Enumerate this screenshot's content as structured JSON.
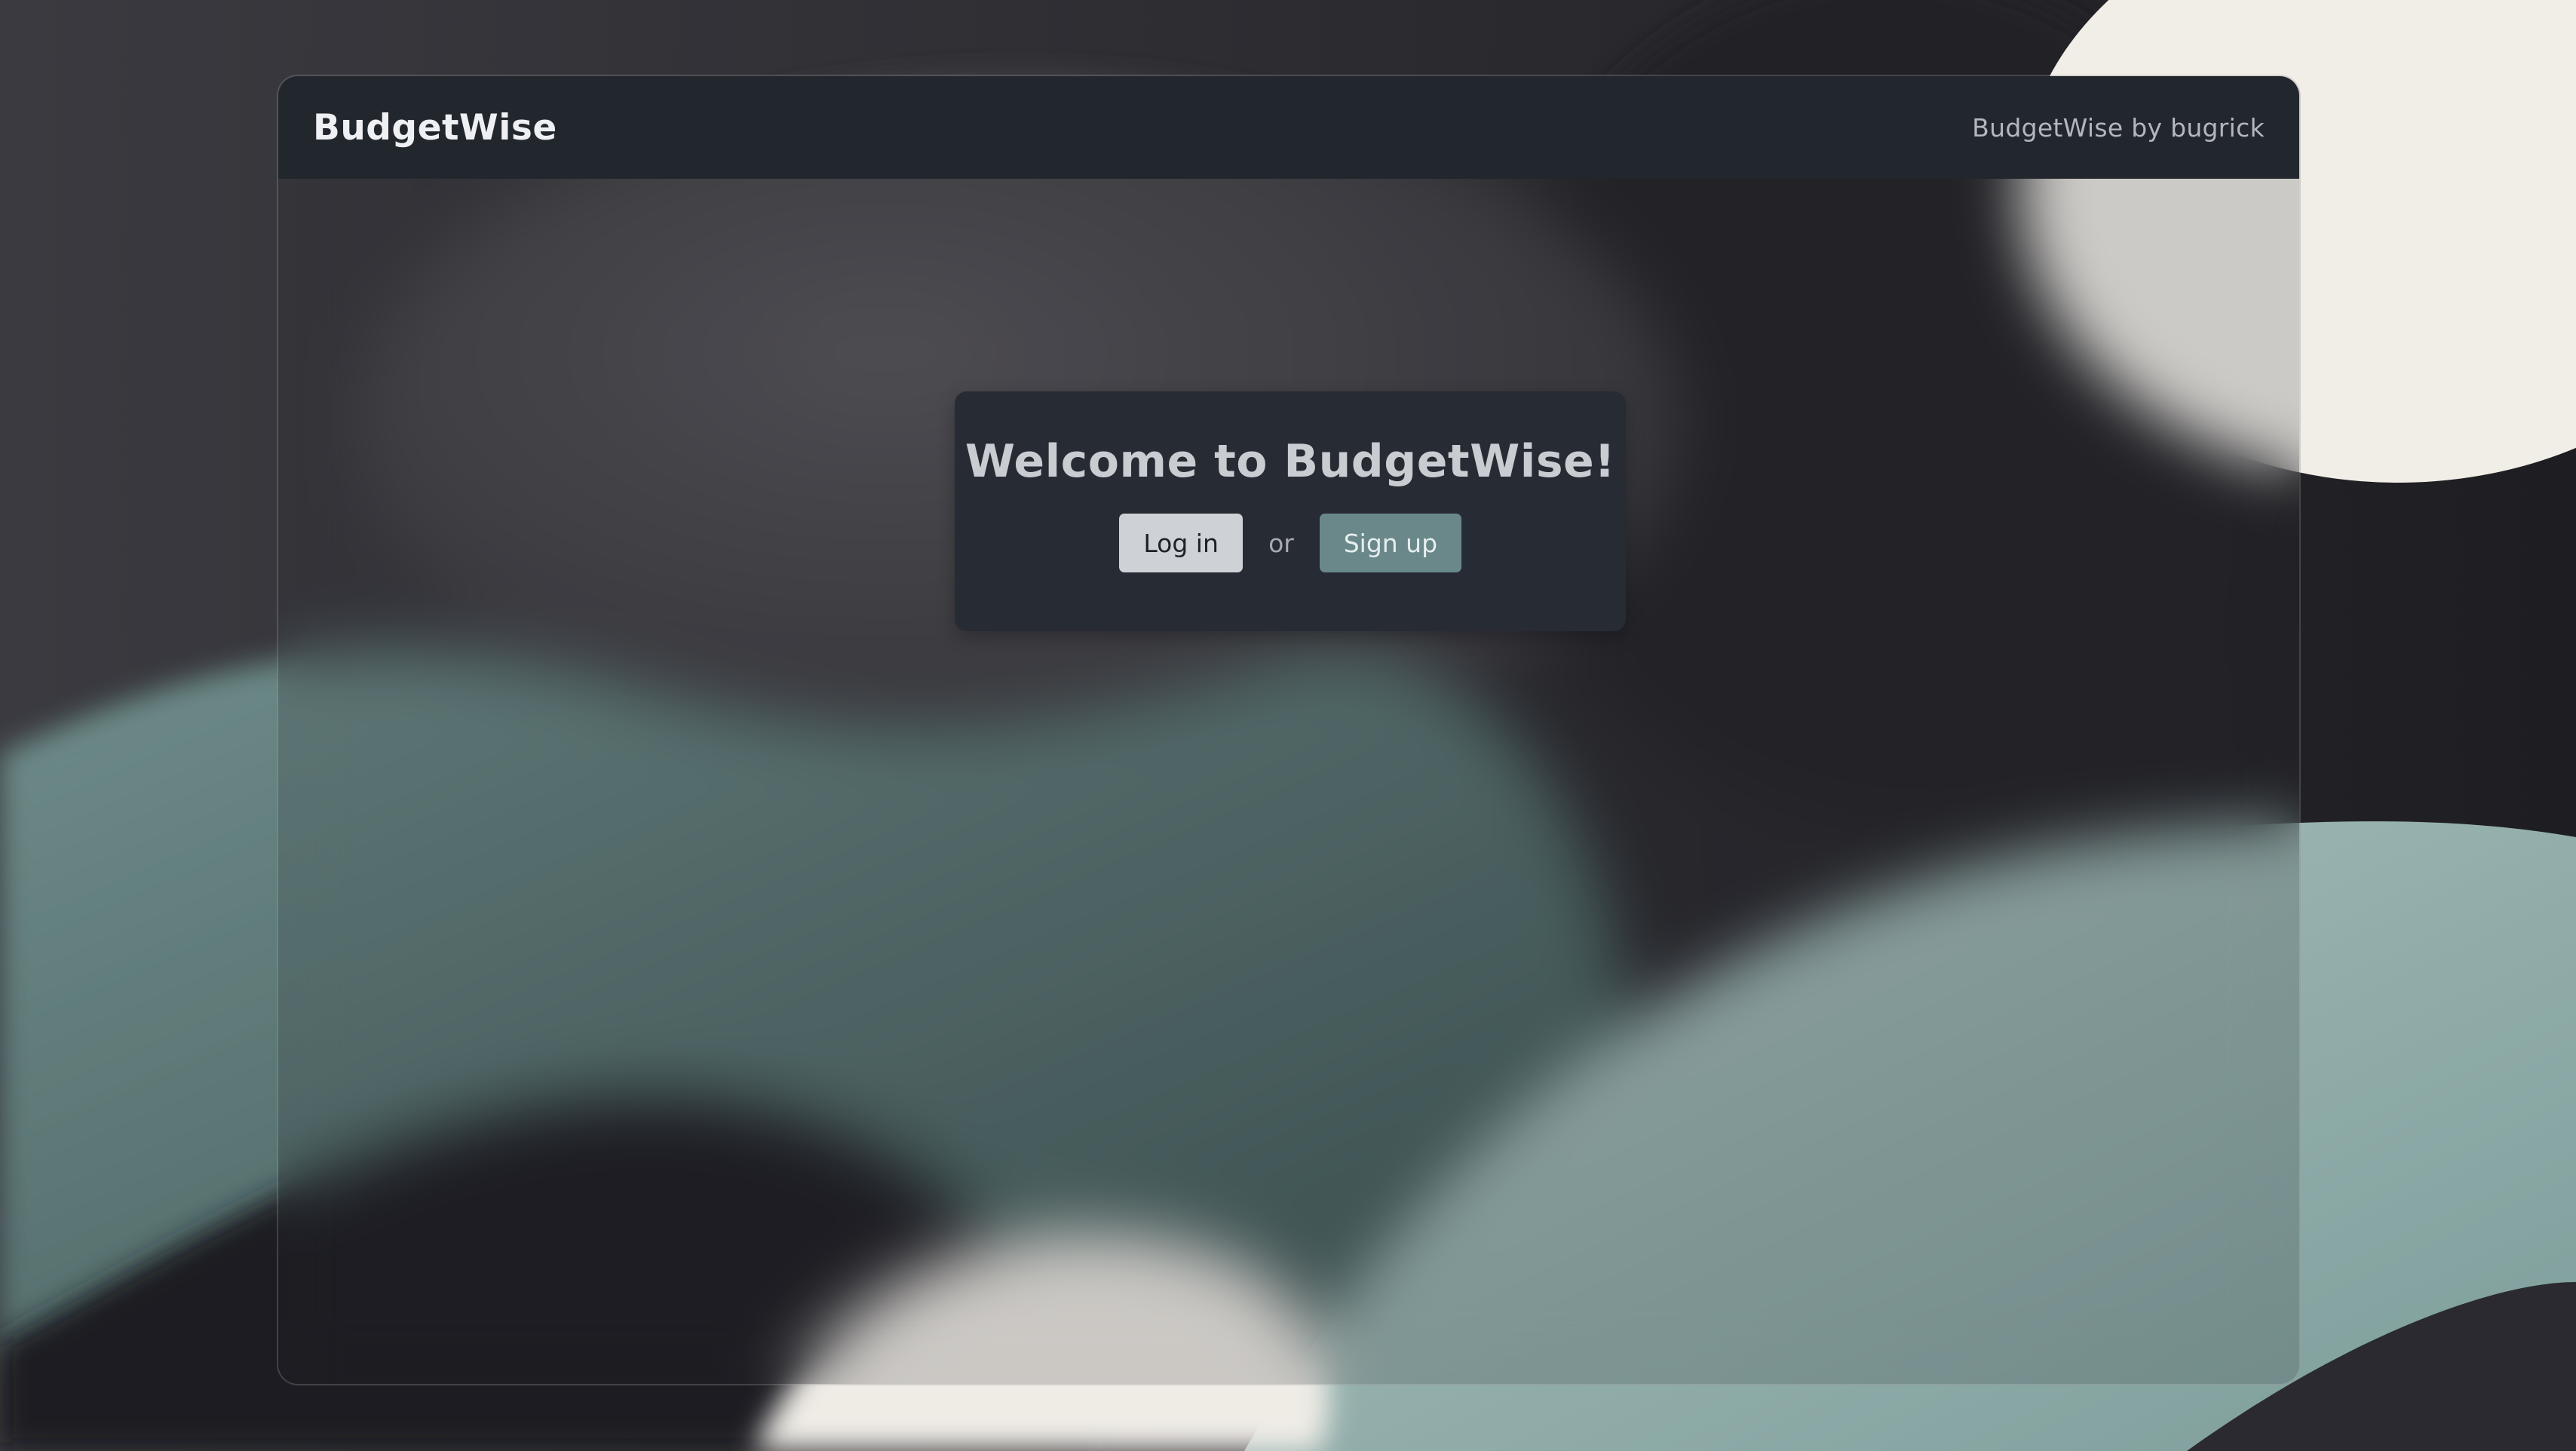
{
  "navbar": {
    "brand": "BudgetWise",
    "credit": "BudgetWise by bugrick"
  },
  "welcome": {
    "title": "Welcome to BudgetWise!",
    "login_label": "Log in",
    "separator": "or",
    "signup_label": "Sign up"
  },
  "colors": {
    "navbar_bg": "#22262d",
    "card_bg": "#272b33",
    "login_bg": "#ced1d5",
    "signup_bg": "#6a8889",
    "wallpaper_teal": "#6f8f8d",
    "wallpaper_light_teal": "#9fb6b3",
    "wallpaper_cream": "#f1eee8"
  }
}
